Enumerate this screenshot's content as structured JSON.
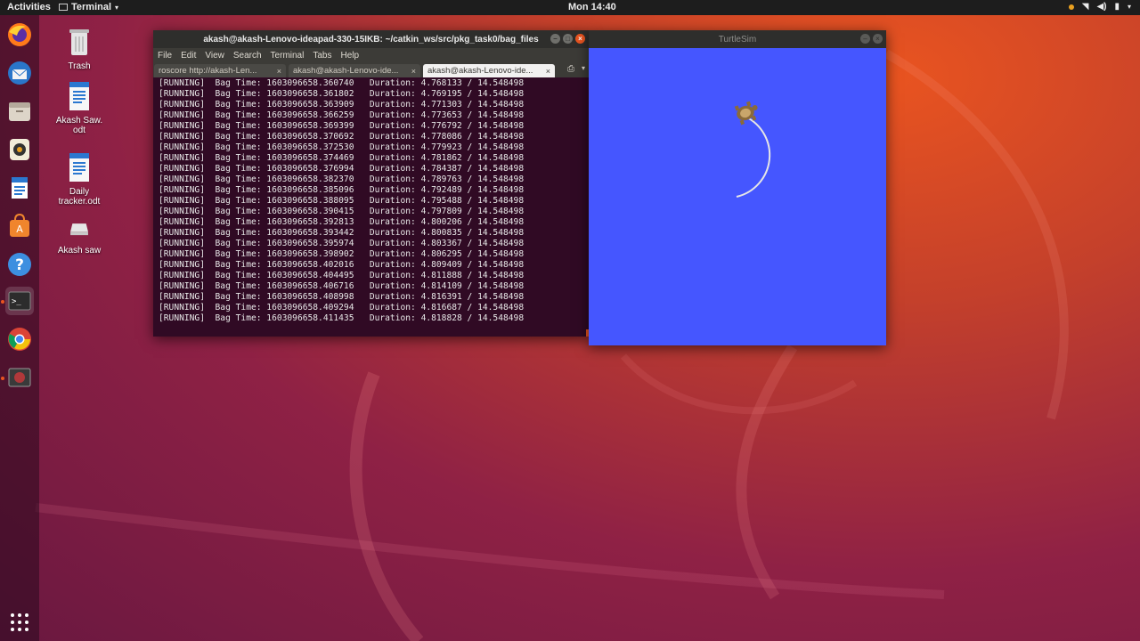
{
  "topbar": {
    "activities": "Activities",
    "app_menu": "Terminal",
    "clock": "Mon 14:40"
  },
  "desktop_icons": [
    {
      "label": "Trash"
    },
    {
      "label": "Akash Saw.\nodt"
    },
    {
      "label": "Daily\ntracker.odt"
    },
    {
      "label": "Akash saw"
    }
  ],
  "terminal": {
    "title": "akash@akash-Lenovo-ideapad-330-15IKB: ~/catkin_ws/src/pkg_task0/bag_files",
    "menu": [
      "File",
      "Edit",
      "View",
      "Search",
      "Terminal",
      "Tabs",
      "Help"
    ],
    "tabs": [
      {
        "label": "roscore http://akash-Len..."
      },
      {
        "label": "akash@akash-Lenovo-ide..."
      },
      {
        "label": "akash@akash-Lenovo-ide..."
      }
    ],
    "lines": [
      "[RUNNING]  Bag Time: 1603096658.360740   Duration: 4.768133 / 14.548498",
      "[RUNNING]  Bag Time: 1603096658.361802   Duration: 4.769195 / 14.548498",
      "[RUNNING]  Bag Time: 1603096658.363909   Duration: 4.771303 / 14.548498",
      "[RUNNING]  Bag Time: 1603096658.366259   Duration: 4.773653 / 14.548498",
      "[RUNNING]  Bag Time: 1603096658.369399   Duration: 4.776792 / 14.548498",
      "[RUNNING]  Bag Time: 1603096658.370692   Duration: 4.778086 / 14.548498",
      "[RUNNING]  Bag Time: 1603096658.372530   Duration: 4.779923 / 14.548498",
      "[RUNNING]  Bag Time: 1603096658.374469   Duration: 4.781862 / 14.548498",
      "[RUNNING]  Bag Time: 1603096658.376994   Duration: 4.784387 / 14.548498",
      "[RUNNING]  Bag Time: 1603096658.382370   Duration: 4.789763 / 14.548498",
      "[RUNNING]  Bag Time: 1603096658.385096   Duration: 4.792489 / 14.548498",
      "[RUNNING]  Bag Time: 1603096658.388095   Duration: 4.795488 / 14.548498",
      "[RUNNING]  Bag Time: 1603096658.390415   Duration: 4.797809 / 14.548498",
      "[RUNNING]  Bag Time: 1603096658.392813   Duration: 4.800206 / 14.548498",
      "[RUNNING]  Bag Time: 1603096658.393442   Duration: 4.800835 / 14.548498",
      "[RUNNING]  Bag Time: 1603096658.395974   Duration: 4.803367 / 14.548498",
      "[RUNNING]  Bag Time: 1603096658.398902   Duration: 4.806295 / 14.548498",
      "[RUNNING]  Bag Time: 1603096658.402016   Duration: 4.809409 / 14.548498",
      "[RUNNING]  Bag Time: 1603096658.404495   Duration: 4.811888 / 14.548498",
      "[RUNNING]  Bag Time: 1603096658.406716   Duration: 4.814109 / 14.548498",
      "[RUNNING]  Bag Time: 1603096658.408998   Duration: 4.816391 / 14.548498",
      "[RUNNING]  Bag Time: 1603096658.409294   Duration: 4.816687 / 14.548498",
      "[RUNNING]  Bag Time: 1603096658.411435   Duration: 4.818828 / 14.548498"
    ]
  },
  "turtlesim": {
    "title": "TurtleSim",
    "background_color": "#4556ff",
    "trail_color": "#e6e6e6"
  },
  "dock": {
    "items": [
      "firefox-icon",
      "thunderbird-icon",
      "files-icon",
      "rhythmbox-icon",
      "writer-icon",
      "software-icon",
      "help-icon",
      "terminal-icon",
      "chrome-icon",
      "disk-icon"
    ],
    "accent": "#e95420"
  },
  "colors": {
    "terminal_bg": "#300a24",
    "panel_bg": "#1d1d1d"
  }
}
